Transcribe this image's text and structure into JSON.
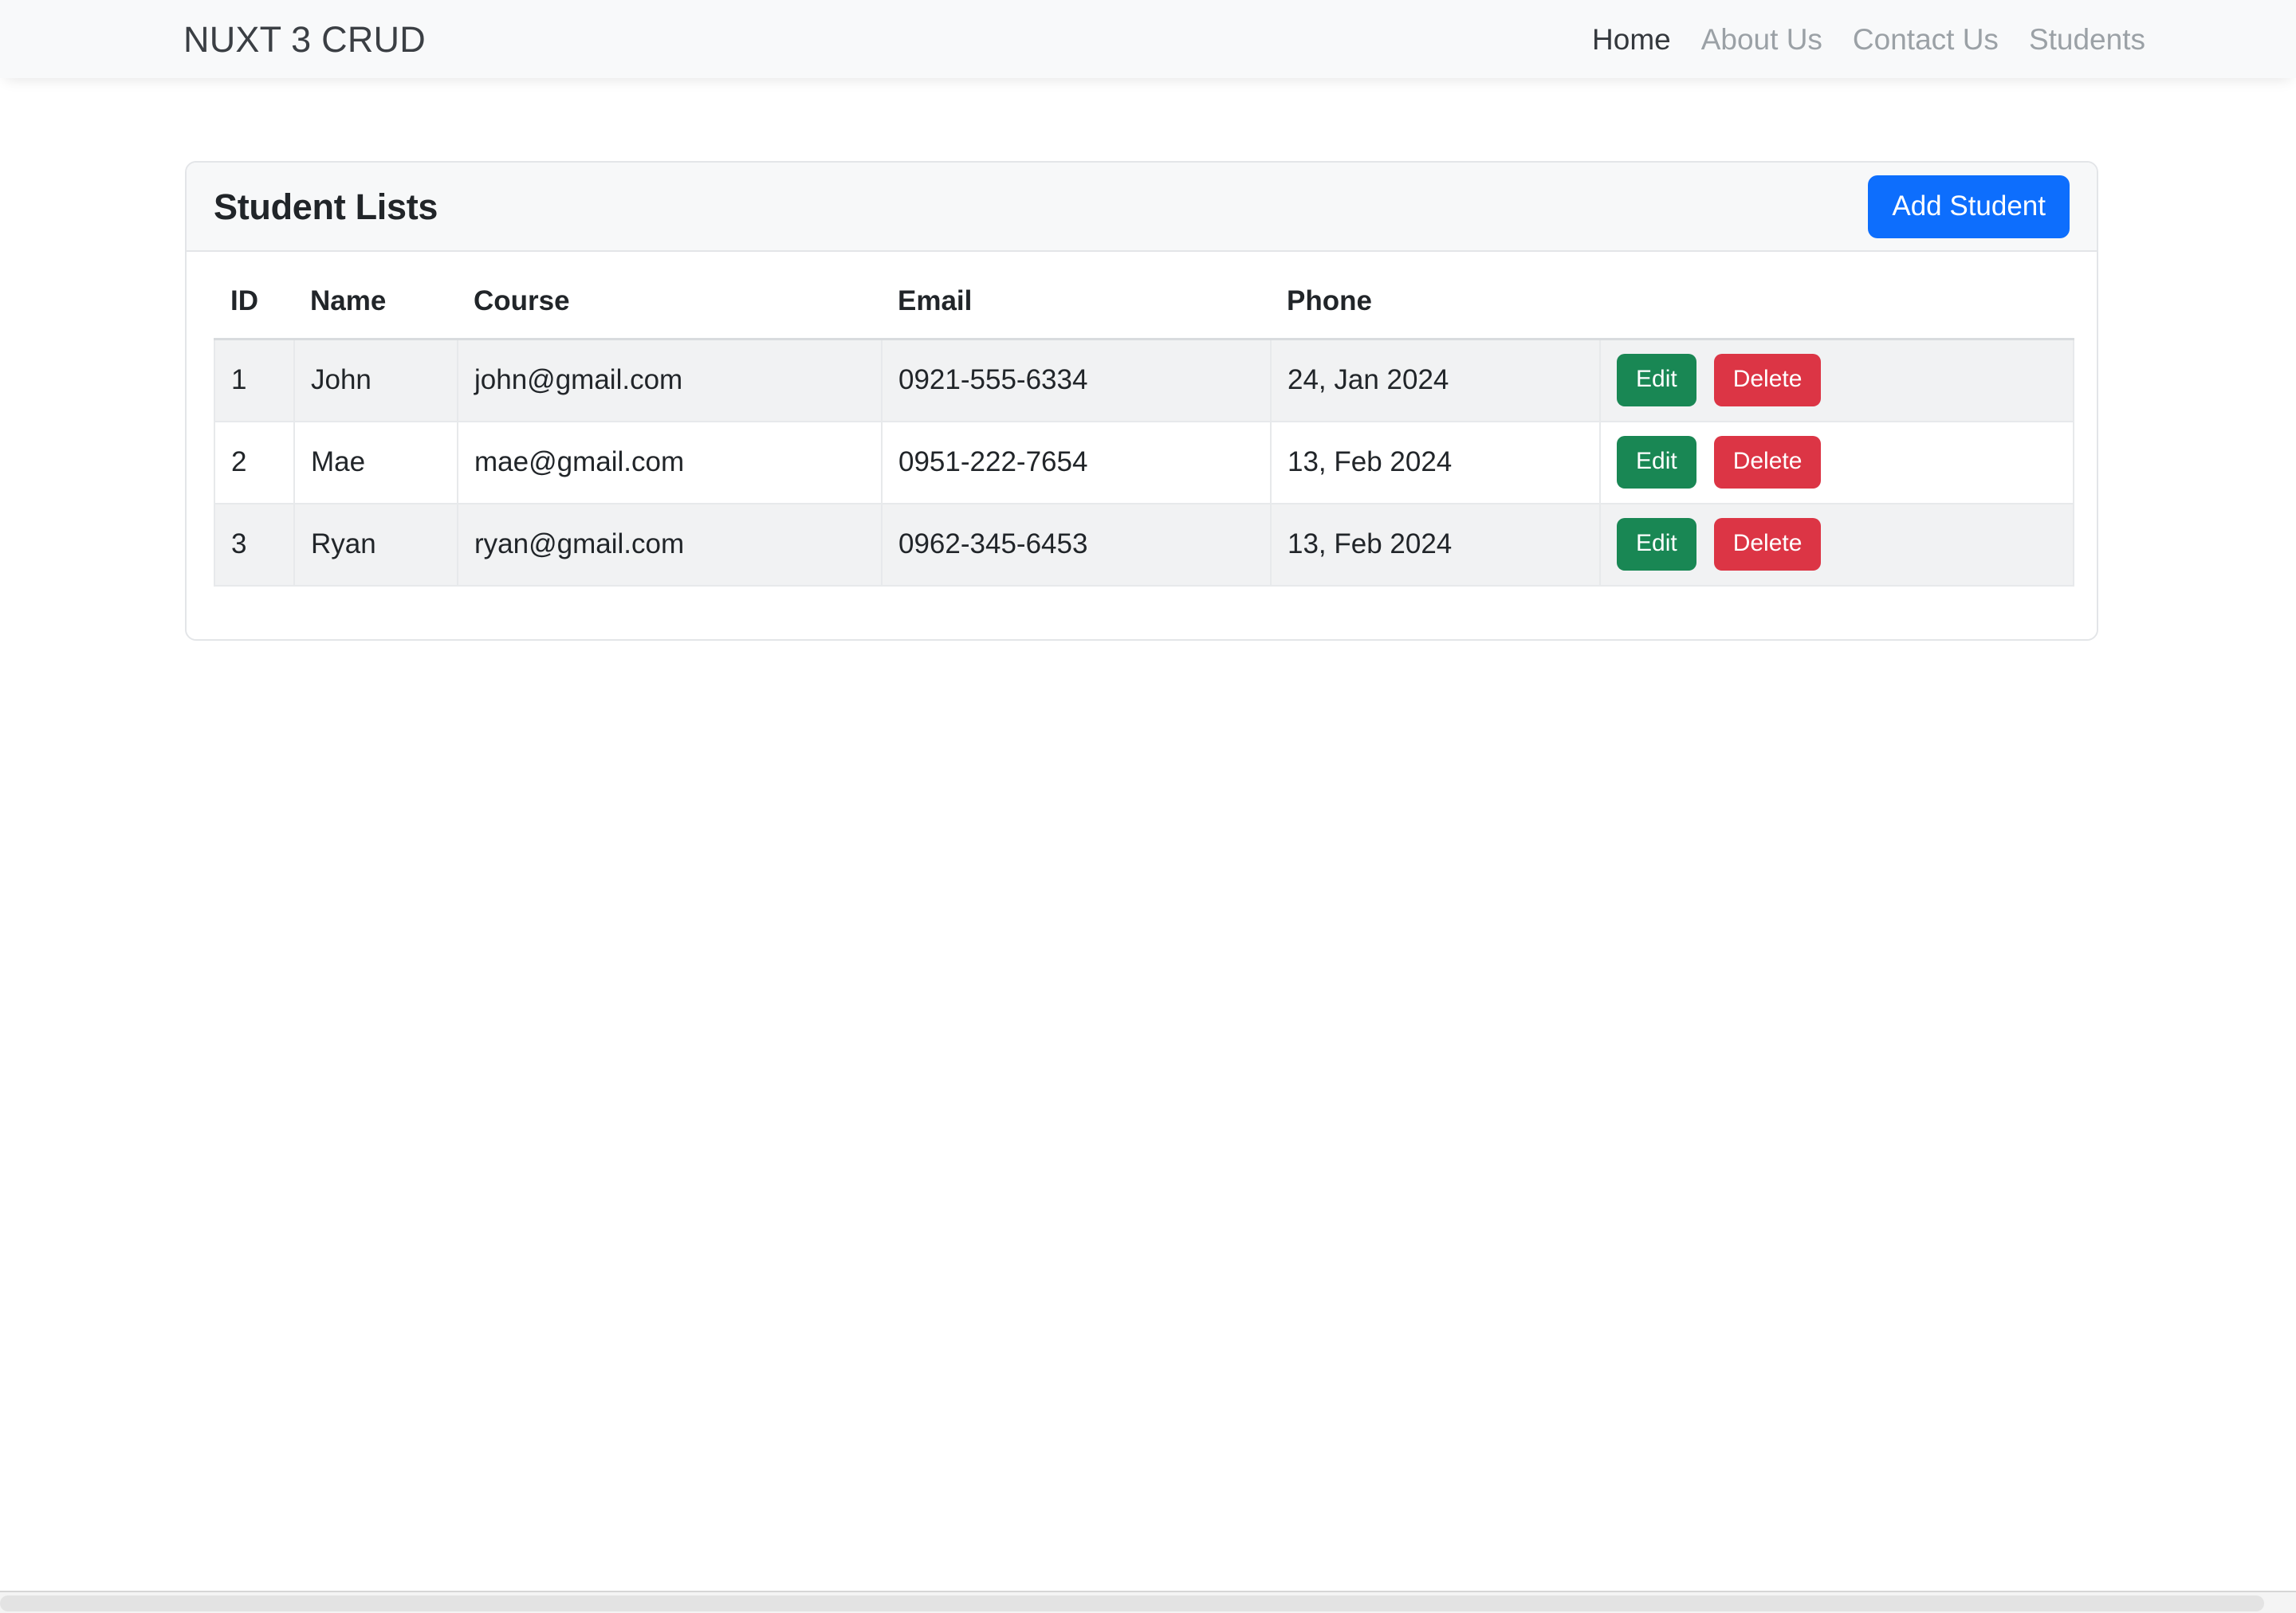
{
  "navbar": {
    "brand": "NUXT 3 CRUD",
    "links": [
      {
        "label": "Home",
        "active": true
      },
      {
        "label": "About Us",
        "active": false
      },
      {
        "label": "Contact Us",
        "active": false
      },
      {
        "label": "Students",
        "active": false
      }
    ]
  },
  "card": {
    "title": "Student Lists",
    "add_button": "Add Student"
  },
  "table": {
    "headers": [
      "ID",
      "Name",
      "Course",
      "Email",
      "Phone",
      ""
    ],
    "rows": [
      {
        "id": "1",
        "name": "John",
        "course": "john@gmail.com",
        "email": "0921-555-6334",
        "phone": "24, Jan 2024",
        "edit_label": "Edit",
        "delete_label": "Delete"
      },
      {
        "id": "2",
        "name": "Mae",
        "course": "mae@gmail.com",
        "email": "0951-222-7654",
        "phone": "13, Feb 2024",
        "edit_label": "Edit",
        "delete_label": "Delete"
      },
      {
        "id": "3",
        "name": "Ryan",
        "course": "ryan@gmail.com",
        "email": "0962-345-6453",
        "phone": "13, Feb 2024",
        "edit_label": "Edit",
        "delete_label": "Delete"
      }
    ]
  },
  "colors": {
    "primary": "#0d6efd",
    "success": "#198754",
    "danger": "#dc3545",
    "navbar_bg": "#f8f9fa",
    "card_header_bg": "#f7f8f9",
    "row_stripe": "#f1f2f3"
  }
}
